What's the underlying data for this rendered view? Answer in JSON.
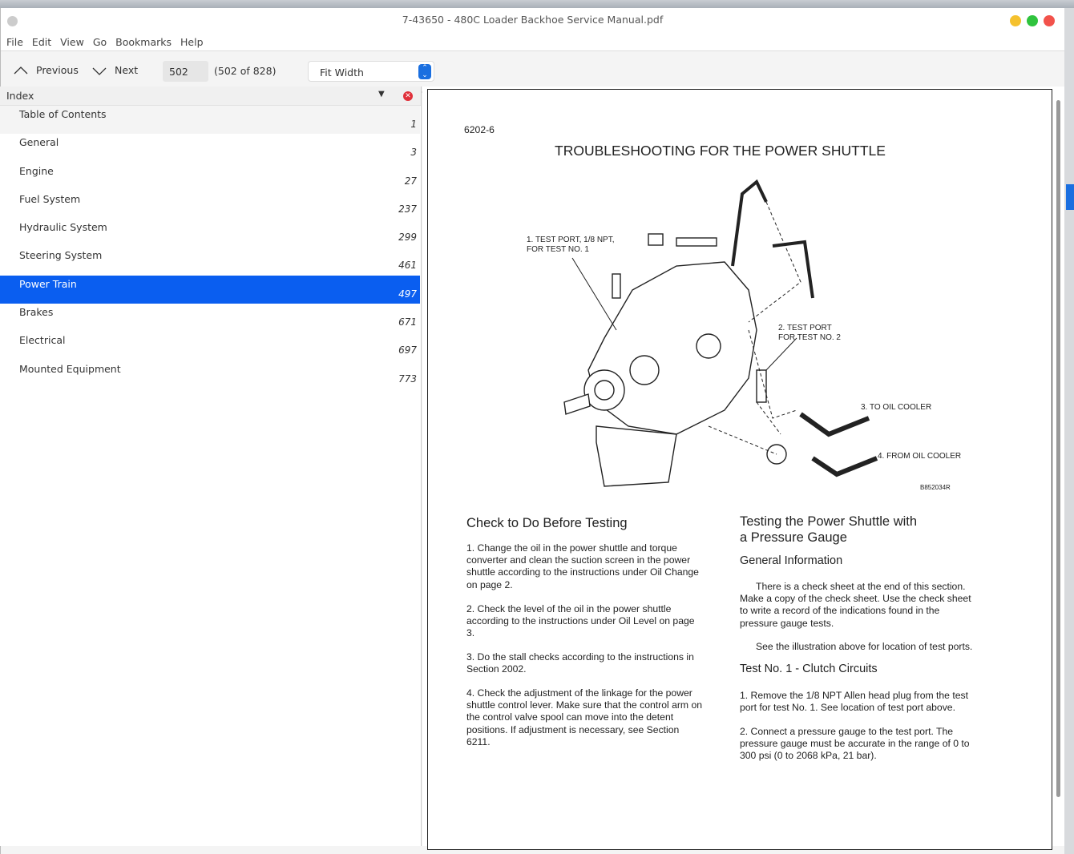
{
  "window": {
    "title": "7-43650 - 480C Loader Backhoe Service Manual.pdf",
    "lights": {
      "minimize": "#f5c12e",
      "maximize": "#2fc33d",
      "close": "#f2524b"
    }
  },
  "menu": [
    "File",
    "Edit",
    "View",
    "Go",
    "Bookmarks",
    "Help"
  ],
  "toolbar": {
    "previous": "Previous",
    "next": "Next",
    "page_input": "502",
    "page_of": "(502 of 828)",
    "zoom": "Fit Width"
  },
  "sidebar": {
    "title": "Index",
    "items": [
      {
        "label": "Table of Contents",
        "page": "1"
      },
      {
        "label": "General",
        "page": "3"
      },
      {
        "label": "Engine",
        "page": "27"
      },
      {
        "label": "Fuel System",
        "page": "237"
      },
      {
        "label": "Hydraulic System",
        "page": "299"
      },
      {
        "label": "Steering System",
        "page": "461"
      },
      {
        "label": "Power Train",
        "page": "497",
        "selected": true
      },
      {
        "label": "Brakes",
        "page": "671"
      },
      {
        "label": "Electrical",
        "page": "697"
      },
      {
        "label": "Mounted Equipment",
        "page": "773"
      }
    ]
  },
  "document": {
    "page_code": "6202-6",
    "title": "TROUBLESHOOTING FOR THE POWER SHUTTLE",
    "illustration": {
      "labels": [
        "1. TEST PORT, 1/8 NPT,",
        "FOR TEST NO. 1",
        "2. TEST PORT",
        "FOR TEST NO. 2",
        "3. TO OIL COOLER",
        "4. FROM OIL COOLER",
        "B852034R"
      ]
    },
    "left": {
      "heading": "Check to Do Before Testing",
      "paras": [
        "1.   Change the oil in the power shuttle and torque converter and clean the suction screen in the power shuttle according to the instructions under Oil Change on page 2.",
        "2.   Check the level of the oil in the power shuttle according to the instructions under Oil Level on page 3.",
        "3.   Do the stall checks according to the instructions in Section 2002.",
        "4.   Check the adjustment of the linkage for the power shuttle control lever. Make sure that the control arm on the control valve spool can move into the detent positions. If adjustment is necessary, see Section 6211."
      ]
    },
    "right": {
      "heading": "Testing the Power Shuttle with a Pressure Gauge",
      "sub1": "General Information",
      "p1": "There is a check sheet at the end of this section. Make a copy of the check sheet. Use the check sheet to write a record of the indications found in the pressure gauge tests.",
      "p2": "See the illustration above for location of test ports.",
      "sub2": "Test No. 1 - Clutch Circuits",
      "p3": "1.   Remove the 1/8 NPT Allen head plug from the test port for test No. 1. See location of test port above.",
      "p4": "2.   Connect a pressure gauge to the test port. The pressure gauge must be accurate in the range of 0 to 300 psi (0 to 2068 kPa, 21 bar)."
    }
  }
}
